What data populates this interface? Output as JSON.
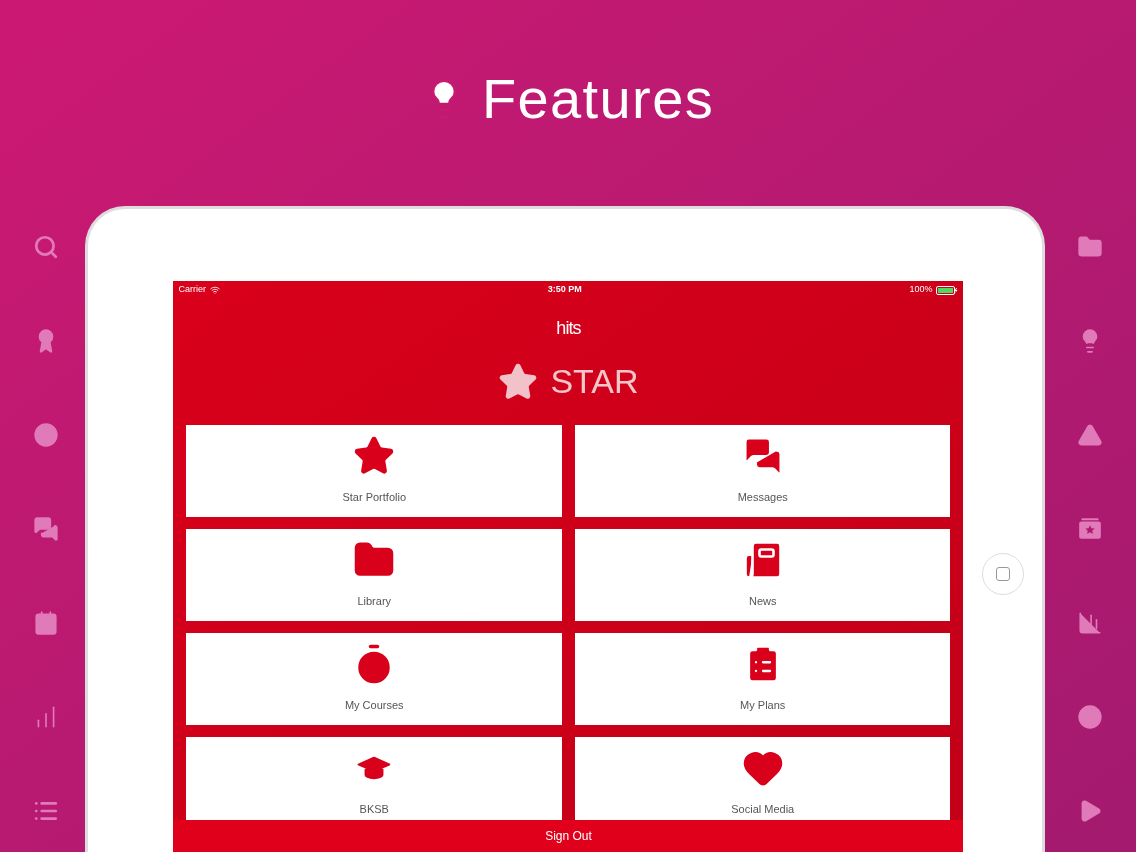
{
  "header": {
    "title": "Features"
  },
  "status_bar": {
    "carrier": "Carrier",
    "time": "3:50 PM",
    "battery": "100%"
  },
  "app": {
    "logo_text": "hits",
    "title": "STAR"
  },
  "tiles": [
    {
      "label": "Star Portfolio"
    },
    {
      "label": "Messages"
    },
    {
      "label": "Library"
    },
    {
      "label": "News"
    },
    {
      "label": "My Courses"
    },
    {
      "label": "My Plans"
    },
    {
      "label": "BKSB"
    },
    {
      "label": "Social Media"
    }
  ],
  "sign_out": {
    "label": "Sign Out"
  }
}
